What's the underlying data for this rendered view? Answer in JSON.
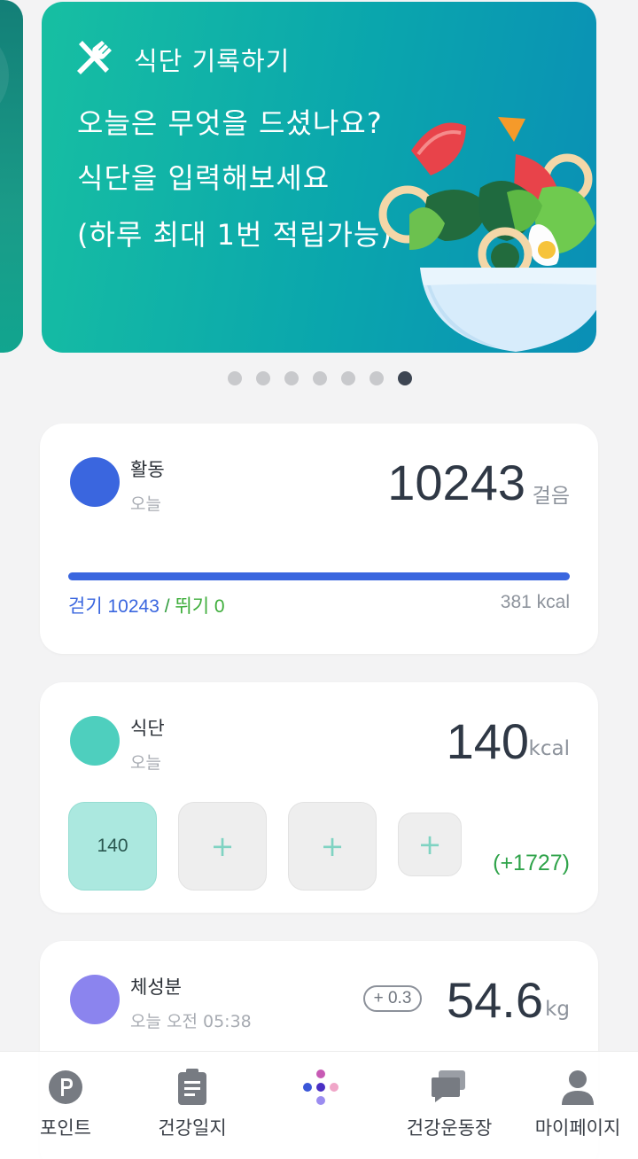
{
  "banner": {
    "title": "식단 기록하기",
    "line1": "오늘은 무엇을 드셨나요?",
    "line2": "식단을 입력해보세요",
    "line3": "(하루 최대 1번 적립가능)",
    "pages": 7,
    "active_page": 7
  },
  "activity": {
    "label": "활동",
    "sub": "오늘",
    "value": "10243",
    "unit": "걸음",
    "walk": "걷기 10243",
    "sep": " / ",
    "run": "뛰기 0",
    "kcal": "381 kcal",
    "progress": 1.0,
    "color": "#3a66df"
  },
  "diet": {
    "label": "식단",
    "sub": "오늘",
    "value": "140",
    "unit": "kcal",
    "meals": [
      "140",
      "+",
      "+",
      "+"
    ],
    "diff": "(+1727)",
    "color": "#4ecfbe"
  },
  "body_comp": {
    "label": "체성분",
    "sub": "오늘 오전 05:38",
    "delta": "+ 0.3",
    "value": "54.6",
    "unit": "kg",
    "color": "#8b84ee"
  },
  "tabs": [
    {
      "label": "포인트",
      "icon": "point-icon"
    },
    {
      "label": "건강일지",
      "icon": "clipboard-icon"
    },
    {
      "label": "",
      "icon": "dots-menu-icon"
    },
    {
      "label": "건강운동장",
      "icon": "chat-icon"
    },
    {
      "label": "마이페이지",
      "icon": "person-icon"
    }
  ]
}
